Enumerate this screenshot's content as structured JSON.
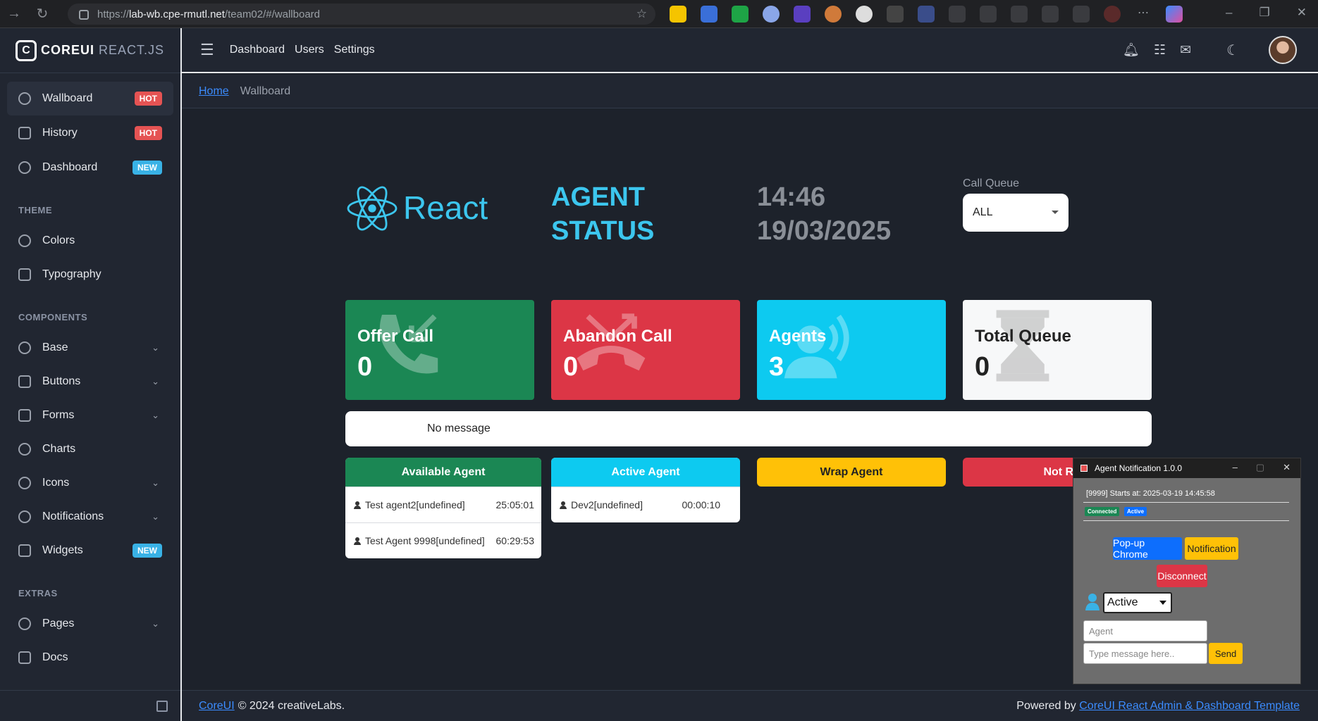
{
  "browser": {
    "url_prefix": "https://",
    "url_host": "lab-wb.cpe-rmutl.net",
    "url_path": "/team02/#/wallboard"
  },
  "sidebar": {
    "brand": "COREUI",
    "brand_sub": "REACT.JS",
    "top_items": [
      {
        "label": "Wallboard",
        "badge": "HOT"
      },
      {
        "label": "History",
        "badge": "HOT"
      },
      {
        "label": "Dashboard",
        "badge": "NEW"
      }
    ],
    "theme_title": "THEME",
    "theme_items": [
      "Colors",
      "Typography"
    ],
    "components_title": "COMPONENTS",
    "component_items": [
      "Base",
      "Buttons",
      "Forms",
      "Charts",
      "Icons",
      "Notifications",
      "Widgets"
    ],
    "widgets_badge": "NEW",
    "extras_title": "EXTRAS",
    "extras_items": [
      "Pages",
      "Docs"
    ]
  },
  "header": {
    "nav": [
      "Dashboard",
      "Users",
      "Settings"
    ]
  },
  "breadcrumb": {
    "home": "Home",
    "current": "Wallboard"
  },
  "wallboard": {
    "logo_text": "React",
    "title_line1": "AGENT",
    "title_line2": "STATUS",
    "time": "14:46",
    "date": "19/03/2025",
    "queue_label": "Call Queue",
    "queue_value": "ALL",
    "cards": [
      {
        "title": "Offer Call",
        "value": "0",
        "color": "#1b8754",
        "icon": "phone-incoming-icon"
      },
      {
        "title": "Abandon Call",
        "value": "0",
        "color": "#dc3646",
        "icon": "phone-missed-icon"
      },
      {
        "title": "Agents",
        "value": "3",
        "color": "#0dcaf0",
        "icon": "agent-broadcast-icon"
      },
      {
        "title": "Total Queue",
        "value": "0",
        "color": "#f7f8f9",
        "icon": "hourglass-icon"
      }
    ],
    "message": "No message",
    "available": {
      "title": "Available Agent",
      "rows": [
        {
          "name": "Test agent2[undefined]",
          "time": "25:05:01"
        },
        {
          "name": "Test Agent 9998[undefined]",
          "time": "60:29:53"
        }
      ]
    },
    "active": {
      "title": "Active Agent",
      "rows": [
        {
          "name": "Dev2[undefined]",
          "time": "00:00:10"
        }
      ]
    },
    "wrap_title": "Wrap Agent",
    "notready_title": "Not Ready"
  },
  "footer": {
    "link": "CoreUI",
    "copyright": "© 2024 creativeLabs.",
    "powered_by": "Powered by",
    "powered_link": "CoreUI React Admin & Dashboard Template"
  },
  "notification_window": {
    "title": "Agent Notification 1.0.0",
    "info": "[9999] Starts at: 2025-03-19 14:45:58",
    "tag_connected": "Connected",
    "tag_active": "Active",
    "btn_popup": "Pop-up Chrome",
    "btn_notification": "Notification",
    "btn_disconnect": "Disconnect",
    "status_value": "Active",
    "agent_placeholder": "Agent",
    "message_placeholder": "Type message here..",
    "btn_send": "Send"
  },
  "colors": {
    "accent_cyan": "#3cc6ee",
    "hot": "#e55353",
    "new": "#39b2e6",
    "success": "#1b8754",
    "danger": "#dc3646",
    "info": "#0dcaf0",
    "warning": "#ffc107"
  }
}
